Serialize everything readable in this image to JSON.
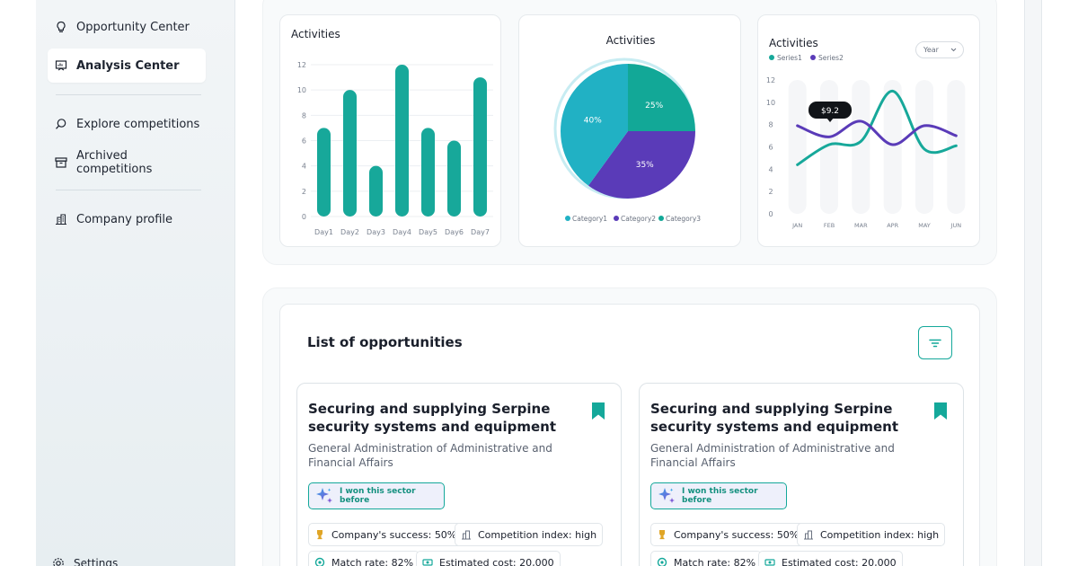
{
  "sidebar": {
    "items": [
      {
        "label": "Opportunity Center",
        "icon": "lightbulb-icon"
      },
      {
        "label": "Analysis Center",
        "icon": "presentation-icon",
        "active": true
      },
      {
        "label": "Explore competitions",
        "icon": "search-icon"
      },
      {
        "label": "Archived competitions",
        "icon": "archive-icon"
      },
      {
        "label": "Company profile",
        "icon": "building-icon"
      }
    ],
    "settings_label": "Settings"
  },
  "charts": {
    "bar_title": "Activities",
    "pie_title": "Activities",
    "line_title": "Activities",
    "line_period_select": "Year",
    "line_tooltip": "$9.2"
  },
  "chart_data": [
    {
      "type": "bar",
      "title": "Activities",
      "categories": [
        "Day1",
        "Day2",
        "Day3",
        "Day4",
        "Day5",
        "Day6",
        "Day7"
      ],
      "values": [
        7,
        10,
        4,
        12,
        7,
        6,
        11
      ],
      "y_ticks": [
        "12",
        "10",
        "8",
        "6",
        "4",
        "2",
        "0"
      ],
      "ylim": [
        0,
        12
      ],
      "color": "#17a89a"
    },
    {
      "type": "pie",
      "title": "Activities",
      "slices": [
        {
          "label": "Category1",
          "value": 40,
          "text": "40%",
          "color": "#21b1c4"
        },
        {
          "label": "Category2",
          "value": 35,
          "text": "35%",
          "color": "#5a3bb8"
        },
        {
          "label": "Category3",
          "value": 25,
          "text": "25%",
          "color": "#12a897"
        }
      ]
    },
    {
      "type": "line",
      "title": "Activities",
      "categories": [
        "JAN",
        "FEB",
        "MAR",
        "APR",
        "MAY",
        "JUN"
      ],
      "y_ticks": [
        "12",
        "10",
        "8",
        "6",
        "4",
        "2",
        "0"
      ],
      "ylim": [
        0,
        12
      ],
      "series": [
        {
          "name": "Series1",
          "color": "#17a89a",
          "values": [
            4.4,
            6.2,
            6.5,
            11.0,
            5.8,
            6.1
          ]
        },
        {
          "name": "Series2",
          "color": "#5a3bb8",
          "values": [
            7.9,
            6.9,
            8.3,
            6.2,
            7.9,
            7.0
          ]
        }
      ]
    }
  ],
  "opportunities": {
    "title": "List of opportunities",
    "items": [
      {
        "title": "Securing and supplying Serpine security systems and equipment",
        "org": "General Administration of Administrative and Financial Affairs",
        "badge": "I won this sector before",
        "success": "Company's success: 50%",
        "competition": "Competition index: high",
        "match": "Match rate: 82%",
        "cost": "Estimated cost: 20,000"
      },
      {
        "title": "Securing and supplying Serpine security systems and equipment",
        "org": "General Administration of Administrative and Financial Affairs",
        "badge": "I won this sector before",
        "success": "Company's success: 50%",
        "competition": "Competition index: high",
        "match": "Match rate: 82%",
        "cost": "Estimated cost: 20,000"
      }
    ]
  },
  "colors": {
    "accent": "#14a89a",
    "purple": "#5a3bb8",
    "cyan": "#21b1c4"
  }
}
